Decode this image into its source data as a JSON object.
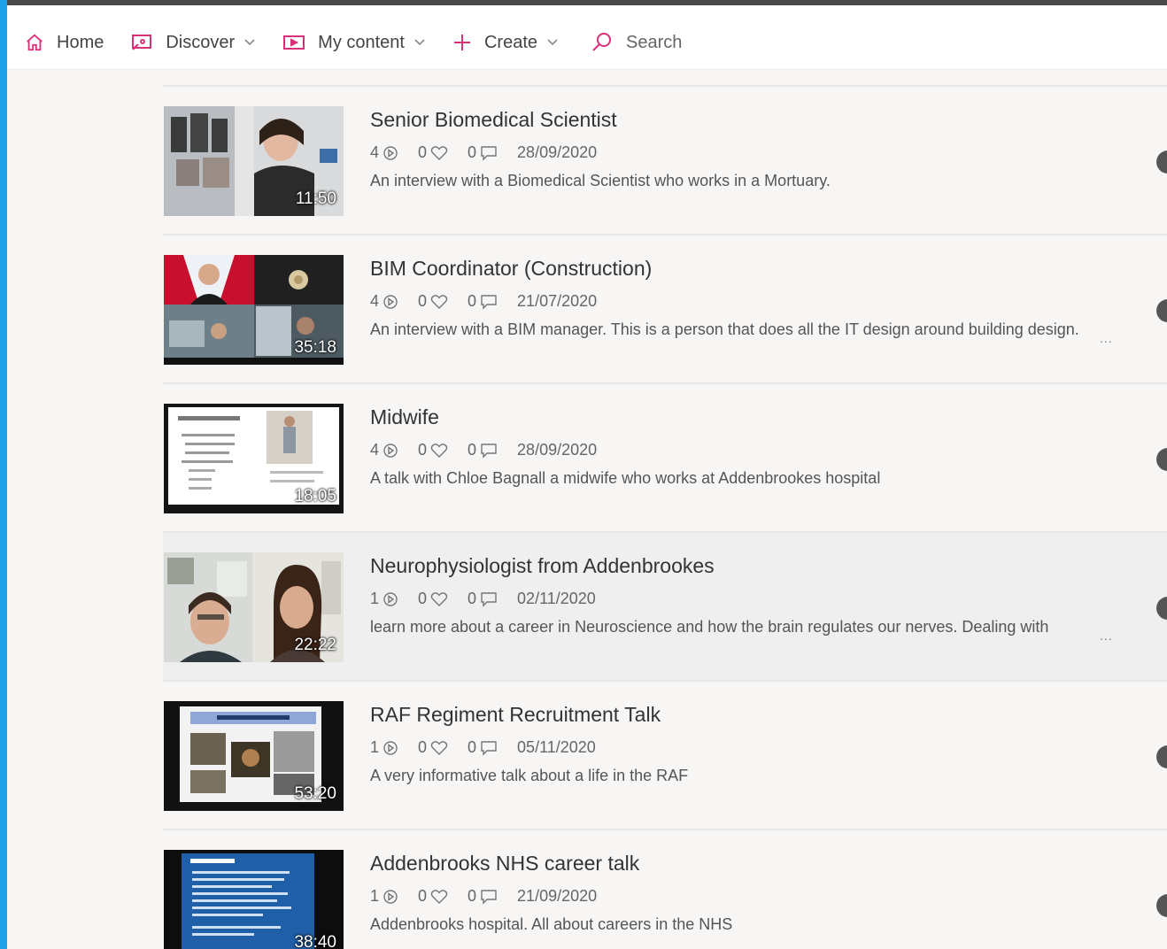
{
  "nav": {
    "home": "Home",
    "discover": "Discover",
    "my_content": "My content",
    "create": "Create",
    "search": "Search"
  },
  "colors": {
    "accent": "#d9307a",
    "window_border": "#1ea0e8",
    "topbar": "#4a4a4a"
  },
  "videos": [
    {
      "title": "Senior Biomedical Scientist",
      "views": "4",
      "likes": "0",
      "comments": "0",
      "date": "28/09/2020",
      "description": "An interview with a Biomedical Scientist who works in a Mortuary.",
      "duration": "11:50",
      "more": ""
    },
    {
      "title": "BIM Coordinator (Construction)",
      "views": "4",
      "likes": "0",
      "comments": "0",
      "date": "21/07/2020",
      "description": "An interview with a BIM manager. This is a person that does all the IT design around building design.",
      "duration": "35:18",
      "more": "..."
    },
    {
      "title": "Midwife",
      "views": "4",
      "likes": "0",
      "comments": "0",
      "date": "28/09/2020",
      "description": "A talk with Chloe Bagnall a midwife who works at Addenbrookes hospital",
      "duration": "18:05",
      "more": ""
    },
    {
      "title": "Neurophysiologist from Addenbrookes",
      "views": "1",
      "likes": "0",
      "comments": "0",
      "date": "02/11/2020",
      "description": "learn more about a career in Neuroscience and how the brain regulates our nerves. Dealing with",
      "duration": "22:22",
      "more": "..."
    },
    {
      "title": "RAF Regiment Recruitment Talk",
      "views": "1",
      "likes": "0",
      "comments": "0",
      "date": "05/11/2020",
      "description": "A very informative talk about a life in the RAF",
      "duration": "53:20",
      "more": ""
    },
    {
      "title": "Addenbrooks NHS career talk",
      "views": "1",
      "likes": "0",
      "comments": "0",
      "date": "21/09/2020",
      "description": "Addenbrooks hospital. All about careers in the NHS",
      "duration": "38:40",
      "more": ""
    }
  ]
}
